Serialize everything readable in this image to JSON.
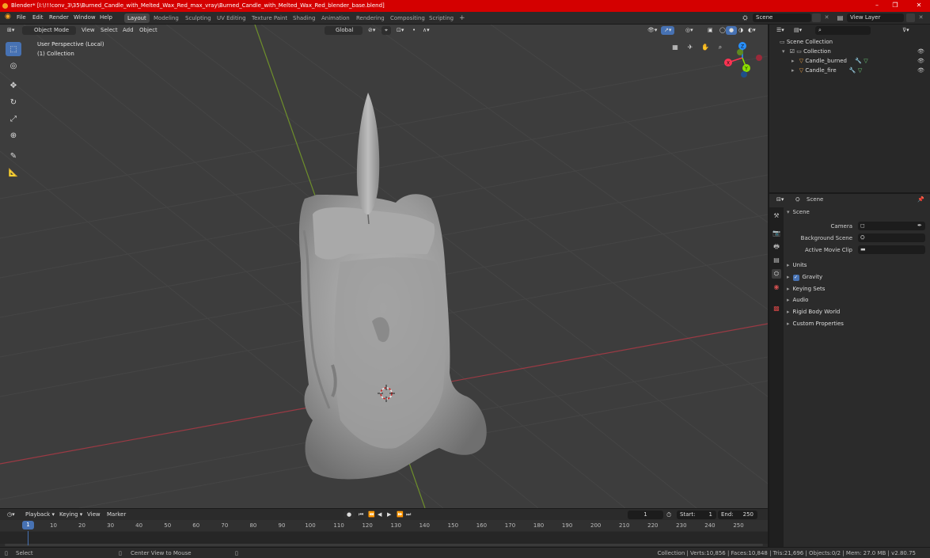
{
  "window": {
    "title": "Blender* [I:\\!!!conv_3\\35\\Burned_Candle_with_Melted_Wax_Red_max_vray\\Burned_Candle_with_Melted_Wax_Red_blender_base.blend]",
    "minimize": "–",
    "maximize": "❐",
    "close": "✕"
  },
  "menus": [
    "File",
    "Edit",
    "Render",
    "Window",
    "Help"
  ],
  "workspaces": [
    "Layout",
    "Modeling",
    "Sculpting",
    "UV Editing",
    "Texture Paint",
    "Shading",
    "Animation",
    "Rendering",
    "Compositing",
    "Scripting"
  ],
  "workspace_add": "+",
  "scene_name": "Scene",
  "view_layer": "View Layer",
  "viewport_header": {
    "mode": "Object Mode",
    "menus": [
      "View",
      "Select",
      "Add",
      "Object"
    ],
    "orientation": "Global"
  },
  "viewport": {
    "perspective": "User Perspective (Local)",
    "collection": "(1) Collection",
    "axes": {
      "x": "X",
      "y": "Y",
      "z": "Z"
    }
  },
  "outliner": {
    "search_placeholder": "",
    "root": "Scene Collection",
    "collection": "Collection",
    "objects": [
      "Candle_burned",
      "Candle_fire"
    ]
  },
  "properties": {
    "header": "Scene",
    "panel": "Scene",
    "fields": [
      {
        "label": "Camera",
        "value": ""
      },
      {
        "label": "Background Scene",
        "value": ""
      },
      {
        "label": "Active Movie Clip",
        "value": ""
      }
    ],
    "subpanels": [
      "Units",
      "Gravity",
      "Keying Sets",
      "Audio",
      "Rigid Body World",
      "Custom Properties"
    ],
    "gravity_checked": true
  },
  "timeline": {
    "menus": [
      "Playback",
      "Keying",
      "View",
      "Marker"
    ],
    "current_frame": "1",
    "start_label": "Start:",
    "start": "1",
    "end_label": "End:",
    "end": "250",
    "ticks": [
      "10",
      "20",
      "30",
      "40",
      "50",
      "60",
      "70",
      "80",
      "90",
      "100",
      "110",
      "120",
      "130",
      "140",
      "150",
      "160",
      "170",
      "180",
      "190",
      "200",
      "210",
      "220",
      "230",
      "240",
      "250"
    ],
    "current_marker": "1"
  },
  "statusbar": {
    "left": "Select",
    "middle": "Center View to Mouse",
    "right": "Collection | Verts:10,856 | Faces:10,848 | Tris:21,696 | Objects:0/2 | Mem: 27.0 MB | v2.80.75"
  },
  "colors": {
    "titlebar": "#d40000",
    "accent": "#4772b3",
    "active_frame": "#4772b3",
    "x_axis": "#ff3352",
    "y_axis": "#8bdc00",
    "z_axis": "#2890ff"
  }
}
